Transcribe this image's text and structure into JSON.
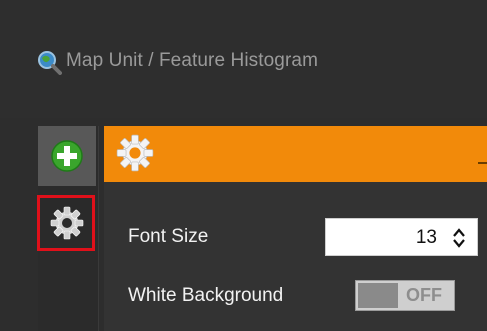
{
  "window": {
    "title": "Map Unit / Feature Histogram",
    "title_icon": "magnifier-globe-icon"
  },
  "rail": {
    "add_icon": "plus-circle-icon",
    "settings_icon": "gear-icon"
  },
  "header": {
    "icon": "gear-icon",
    "pin_icon": "pin-icon"
  },
  "settings": {
    "font_size_label": "Font Size",
    "font_size_value": "13",
    "white_background_label": "White Background",
    "white_background_state": "OFF"
  },
  "colors": {
    "accent": "#f28a0a",
    "highlight": "#e0101a",
    "add_green": "#3aa52c"
  }
}
